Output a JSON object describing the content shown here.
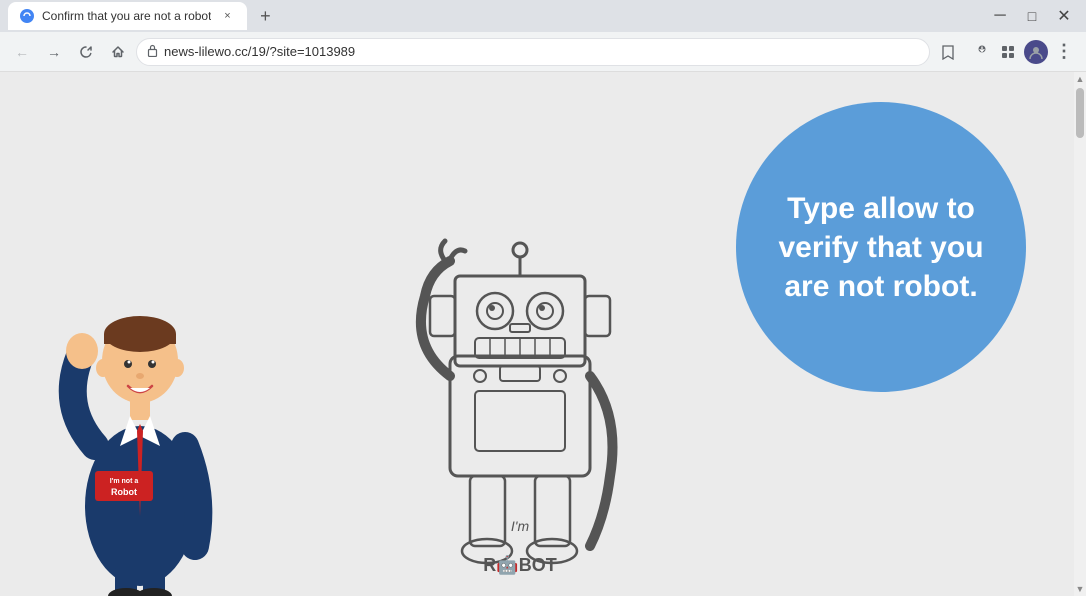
{
  "browser": {
    "title_bar": {
      "tab_title": "Confirm that you are not a robot",
      "tab_close_label": "×",
      "new_tab_label": "+"
    },
    "toolbar": {
      "back_btn": "←",
      "forward_btn": "→",
      "reload_btn": "↻",
      "home_btn": "⌂",
      "address": "news-lilewo.cc/19/?site=1013989",
      "bookmark_icon": "☆",
      "extensions_icon": "🧩",
      "profile_icon": "👤",
      "menu_icon": "⋮",
      "downloads_icon": "⬇"
    },
    "page": {
      "circle_text": "Type allow to verify that you are not robot.",
      "background_color": "#ebebeb"
    }
  },
  "icons": {
    "lock": "🔒",
    "star": "☆",
    "puzzle": "⬛",
    "account": "⬛",
    "dots": "⋮",
    "down_arrow": "▾",
    "up_arrow": "▴"
  }
}
